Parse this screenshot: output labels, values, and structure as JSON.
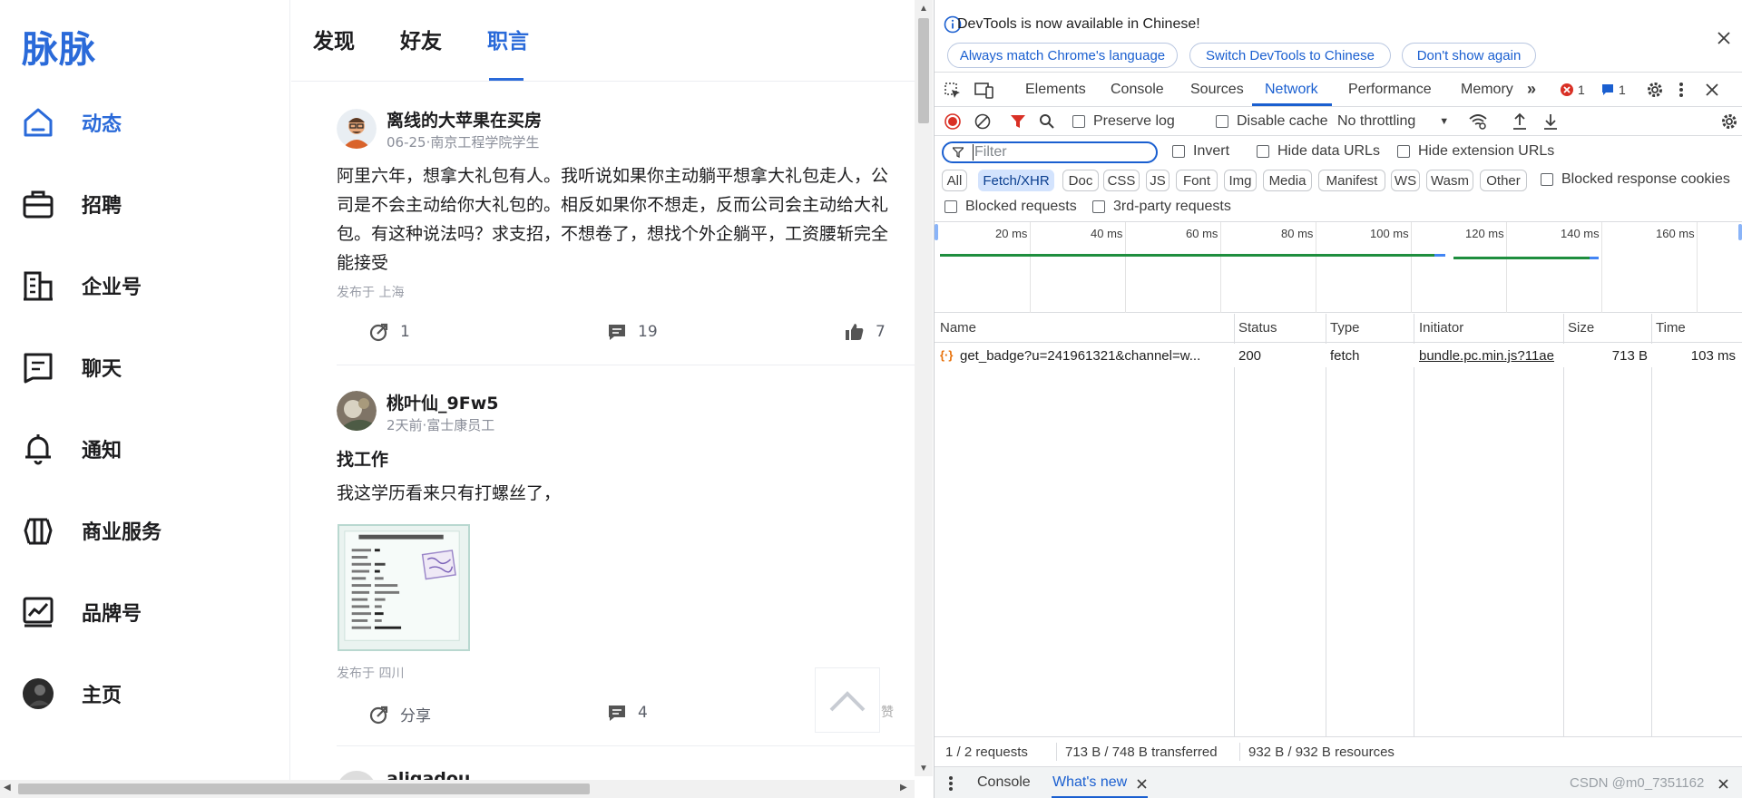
{
  "web": {
    "logo": "脉脉",
    "nav": [
      {
        "label": "动态",
        "icon": "home-icon",
        "active": true
      },
      {
        "label": "招聘",
        "icon": "briefcase-icon"
      },
      {
        "label": "企业号",
        "icon": "building-icon"
      },
      {
        "label": "聊天",
        "icon": "chat-icon"
      },
      {
        "label": "通知",
        "icon": "bell-icon"
      },
      {
        "label": "商业服务",
        "icon": "business-service-icon"
      },
      {
        "label": "品牌号",
        "icon": "chart-icon"
      },
      {
        "label": "主页",
        "icon": "user-avatar-icon"
      }
    ],
    "tabs": [
      {
        "label": "发现"
      },
      {
        "label": "好友"
      },
      {
        "label": "职言",
        "active": true
      }
    ],
    "posts": [
      {
        "author": "离线的大苹果在买房",
        "meta": "06-25·南京工程学院学生",
        "text": "阿里六年，想拿大礼包有人。我听说如果你主动躺平想拿大礼包走人，公\n司是不会主动给你大礼包的。相反如果你不想走，反而公司会主动给大礼\n包。有这种说法吗？求支招，不想卷了，想找个外企躺平，工资腰斩完全\n能接受",
        "location": "发布于 上海",
        "forwards": "1",
        "comments": "19",
        "likes": "7"
      },
      {
        "author": "桃叶仙_9Fw5",
        "meta": "2天前·富士康员工",
        "title": "找工作",
        "text": "我这学历看来只有打螺丝了，",
        "location": "发布于 四川",
        "share_label": "分享",
        "comments": "4",
        "partial_action": "赞"
      },
      {
        "author": "aligadou"
      }
    ]
  },
  "devtools": {
    "banner_text": "DevTools is now available in Chinese!",
    "banner_buttons": [
      "Always match Chrome's language",
      "Switch DevTools to Chinese",
      "Don't show again"
    ],
    "tabs": [
      "Elements",
      "Console",
      "Sources",
      "Network",
      "Performance",
      "Memory"
    ],
    "active_tab": "Network",
    "error_count": "1",
    "message_count": "1",
    "toolbar": {
      "preserve_log": "Preserve log",
      "disable_cache": "Disable cache",
      "throttling": "No throttling"
    },
    "filter_placeholder": "Filter",
    "filter_options": [
      "Invert",
      "Hide data URLs",
      "Hide extension URLs"
    ],
    "type_filters": [
      "All",
      "Fetch/XHR",
      "Doc",
      "CSS",
      "JS",
      "Font",
      "Img",
      "Media",
      "Manifest",
      "WS",
      "Wasm",
      "Other"
    ],
    "selected_type_filter": "Fetch/XHR",
    "blocked_response_cookies": "Blocked response cookies",
    "blocked_requests": "Blocked requests",
    "third_party": "3rd-party requests",
    "timeline_ticks": [
      "20 ms",
      "40 ms",
      "60 ms",
      "80 ms",
      "100 ms",
      "120 ms",
      "140 ms",
      "160 ms"
    ],
    "columns": [
      "Name",
      "Status",
      "Type",
      "Initiator",
      "Size",
      "Time"
    ],
    "requests": [
      {
        "name": "get_badge?u=241961321&channel=w...",
        "status": "200",
        "type": "fetch",
        "initiator": "bundle.pc.min.js?11ae",
        "size": "713 B",
        "time": "103 ms"
      }
    ],
    "status": {
      "requests": "1 / 2 requests",
      "transferred": "713 B / 748 B transferred",
      "resources": "932 B / 932 B resources"
    },
    "drawer_tabs": [
      "Console",
      "What's new"
    ],
    "watermark": "CSDN @m0_7351162"
  }
}
